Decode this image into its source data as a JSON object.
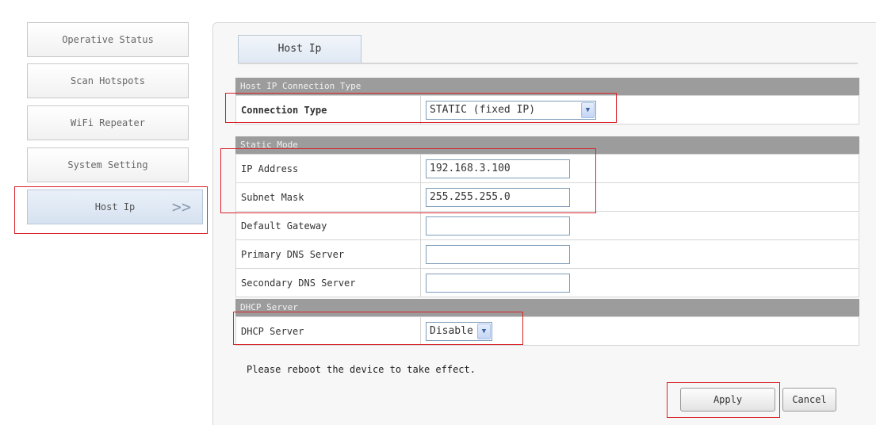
{
  "sidebar": {
    "items": [
      {
        "label": "Operative Status"
      },
      {
        "label": "Scan Hotspots"
      },
      {
        "label": "WiFi Repeater"
      },
      {
        "label": "System Setting"
      },
      {
        "label": "Host Ip",
        "arrow": ">>",
        "selected": true
      }
    ]
  },
  "tab": {
    "label": "Host Ip"
  },
  "sections": {
    "connection_type": {
      "header": "Host IP Connection Type",
      "label": "Connection Type",
      "value": "STATIC (fixed IP)"
    },
    "static_mode": {
      "header": "Static Mode",
      "fields": [
        {
          "label": "IP Address",
          "value": "192.168.3.100"
        },
        {
          "label": "Subnet Mask",
          "value": "255.255.255.0"
        },
        {
          "label": "Default Gateway",
          "value": ""
        },
        {
          "label": "Primary DNS Server",
          "value": ""
        },
        {
          "label": "Secondary DNS Server",
          "value": ""
        }
      ]
    },
    "dhcp": {
      "header": "DHCP Server",
      "label": "DHCP Server",
      "value": "Disable"
    }
  },
  "note": "Please reboot the device to take effect.",
  "buttons": {
    "apply": "Apply",
    "cancel": "Cancel"
  },
  "colors": {
    "highlight": "#d9232b",
    "section_header": "#9c9c9c",
    "active_tab": "#dfe8f3"
  }
}
